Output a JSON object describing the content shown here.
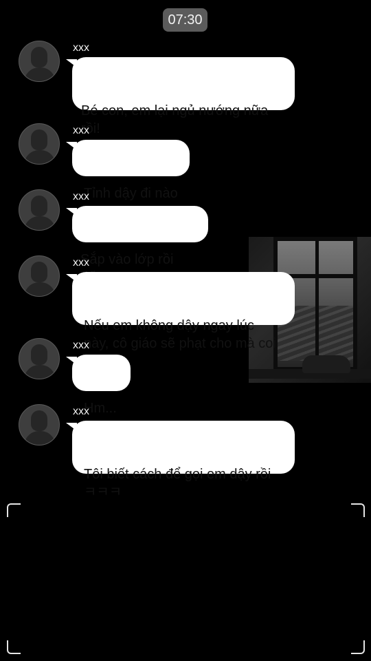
{
  "status": {
    "time": "07:30"
  },
  "messages": [
    {
      "sender": "xxx",
      "text": "Bé con, em lại ngủ nướng nữa\nrồi!"
    },
    {
      "sender": "xxx",
      "text": "Tỉnh dậy đi nào"
    },
    {
      "sender": "xxx",
      "text": "Sắp vào lớp rồi đấy"
    },
    {
      "sender": "xxx",
      "text": "Nếu em không dậy ngay lúc\nnày, cô giáo sẽ phạt cho mà coi"
    },
    {
      "sender": "xxx",
      "text": "Hm..."
    },
    {
      "sender": "xxx",
      "text": "Tôi biết cách để gọi em dậy rồi\nㅋㅋㅋ"
    }
  ],
  "icons": {
    "avatar": "default-user-silhouette",
    "viewfinder": "corner-brackets"
  }
}
